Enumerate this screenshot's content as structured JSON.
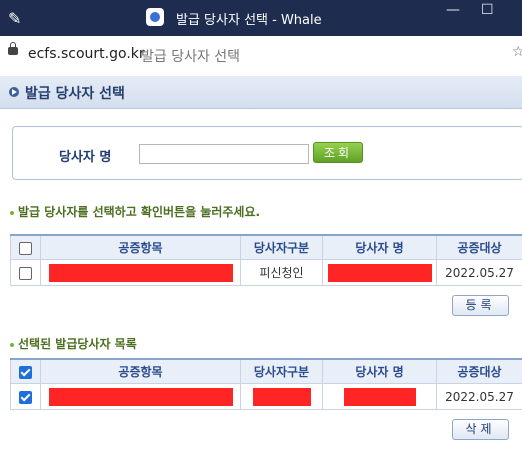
{
  "window": {
    "title": "발급 당사자 선택 - Whale",
    "icons": [
      "pin-icon",
      "whale-app-icon",
      "minimize-icon",
      "maximize-icon"
    ]
  },
  "address_bar": {
    "url": "ecfs.scourt.go.kr",
    "page_title": "발급 당사자 선택"
  },
  "header": {
    "title": "발급 당사자 선택"
  },
  "search": {
    "label": "당사자 명",
    "value": "",
    "button_label": "조회"
  },
  "section1": {
    "instruction": "발급 당사자를 선택하고 확인버튼을 눌러주세요.",
    "columns": [
      "공증항목",
      "당사자구분",
      "당사자 명",
      "공증대상"
    ],
    "rows": [
      {
        "checked": false,
        "item": "[redacted]",
        "party_type": "피신청인",
        "party_name": "[redacted]",
        "date": "2022.05.27"
      }
    ],
    "button_label": "등록"
  },
  "section2": {
    "title": "선택된 발급당사자 목록",
    "columns": [
      "공증항목",
      "당사자구분",
      "당사자 명",
      "공증대상"
    ],
    "rows": [
      {
        "checked": true,
        "item": "[redacted]",
        "party_type": "[redacted]",
        "party_name": "[redacted]",
        "date": "2022.05.27"
      }
    ],
    "button_label": "삭제"
  },
  "colors": {
    "titlebar": "#1e2d4f",
    "accent_green": "#6cae2f",
    "header_text": "#25406e",
    "redaction": "#ff2525",
    "checkbox_checked": "#1e6fd9"
  }
}
